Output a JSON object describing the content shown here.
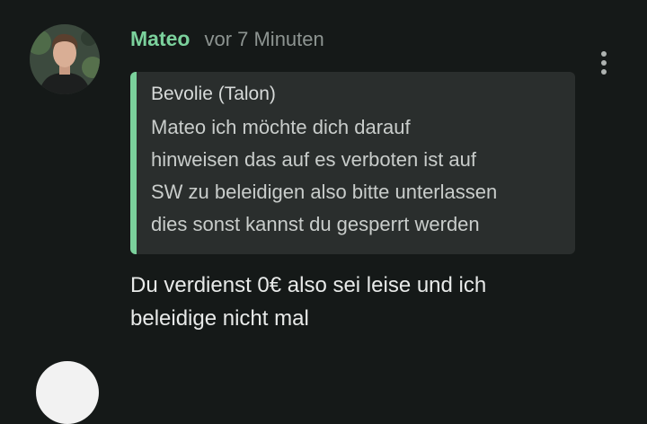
{
  "comment": {
    "username": "Mateo",
    "timestamp": "vor 7 Minuten",
    "quote": {
      "author": "Bevolie (Talon)",
      "lines": [
        "Mateo ich möchte dich darauf",
        "hinweisen das auf es verboten ist auf",
        "SW zu beleidigen also bitte unterlassen",
        "dies sonst kannst du gesperrt werden"
      ]
    },
    "message_lines": [
      "Du verdienst 0€ also sei leise und ich",
      "beleidige nicht mal"
    ]
  },
  "colors": {
    "background": "#151918",
    "username": "#7bd19c",
    "quote_bar": "#7bd19c",
    "quote_bg": "#2a2e2d"
  },
  "icons": {
    "menu": "more-vertical-icon",
    "avatar": "user-avatar"
  }
}
